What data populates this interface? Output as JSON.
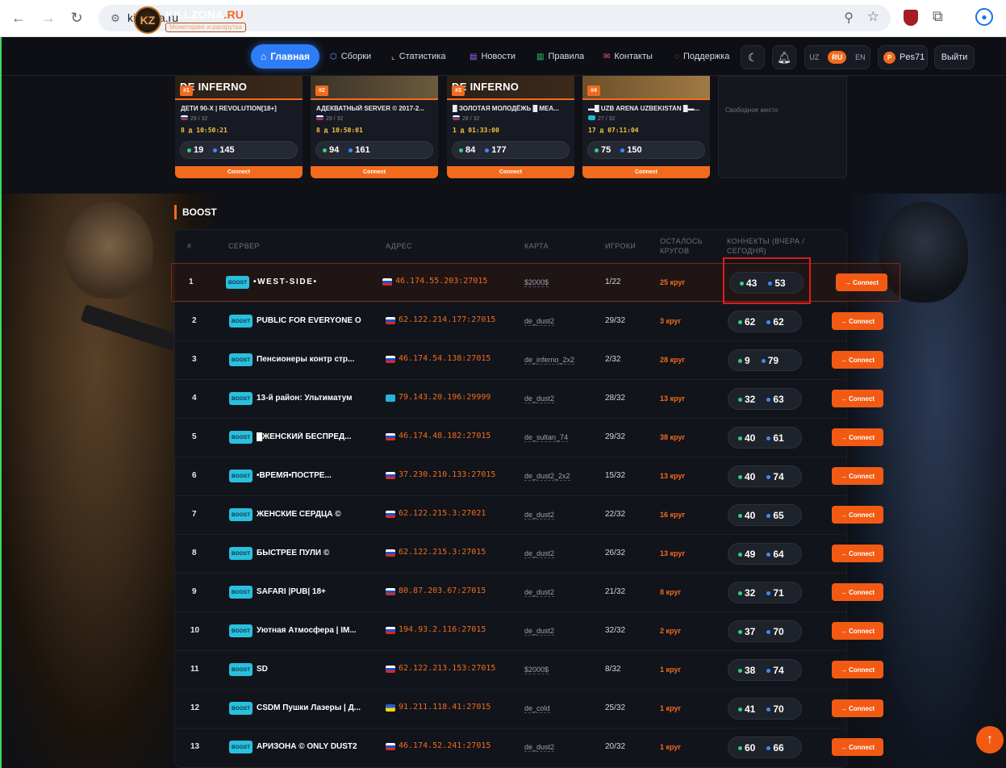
{
  "browser": {
    "url": "killzona.ru"
  },
  "header": {
    "logo_mark": "KZ",
    "logo_main": "KILLZONA",
    "logo_tld": ".RU",
    "logo_sub": "Мониторинг и раскрутка",
    "nav": [
      {
        "label": "Главная",
        "icon": "home-icon"
      },
      {
        "label": "Сборки",
        "icon": "box-icon"
      },
      {
        "label": "Статистика",
        "icon": "chart-icon"
      },
      {
        "label": "Новости",
        "icon": "news-icon"
      },
      {
        "label": "Правила",
        "icon": "rules-icon"
      },
      {
        "label": "Контакты",
        "icon": "mail-icon"
      },
      {
        "label": "Поддержка",
        "icon": "support-icon"
      }
    ],
    "langs": [
      "UZ",
      "RU",
      "EN"
    ],
    "active_lang": "RU",
    "user": {
      "initial": "P",
      "name": "Pes71"
    },
    "logout_label": "Выйти"
  },
  "top_cards": [
    {
      "banner": "DE INFERNO",
      "rank": "#1",
      "name": "ДЕТИ 90-Х | REVOLUTION[18+]",
      "players": "29 / 32",
      "timer": "8 д 10:50:21",
      "green": "19",
      "blue": "145",
      "connect": "Connect"
    },
    {
      "banner": "",
      "rank": "#2",
      "name": "АДЕКВАТНЫЙ SERVER © 2017-2...",
      "players": "29 / 32",
      "timer": "8 д 10:50:01",
      "green": "94",
      "blue": "161",
      "connect": "Connect"
    },
    {
      "banner": "DE INFERNO",
      "rank": "#3",
      "name": "█ ЗОЛОТАЯ МОЛОДЁЖЬ █ MEA...",
      "players": "28 / 32",
      "timer": "1 д 01:33:00",
      "green": "84",
      "blue": "177",
      "connect": "Connect"
    },
    {
      "banner": "",
      "rank": "#4",
      "name": "▬█ UZB ARENA UZBEKISTAN █▬...",
      "players": "27 / 32",
      "timer": "17 д 07:11:04",
      "green": "75",
      "blue": "150",
      "connect": "Connect"
    }
  ],
  "free_slot": "Свободное место",
  "boost": {
    "heading": "BOOST",
    "columns": {
      "num": "#",
      "server": "СЕРВЕР",
      "address": "АДРЕС",
      "map": "КАРТА",
      "players": "ИГРОКИ",
      "rounds": "ОСТАЛОСЬ КРУГОВ",
      "connects": "КОННЕКТЫ (ВЧЕРА / СЕГОДНЯ)"
    },
    "badge": "BOOST",
    "connect_label": "→ Connect",
    "rows": [
      {
        "n": "1",
        "name": "•WEST-SIDE•",
        "flag": "ru",
        "addr": "46.174.55.203:27015",
        "map": "$2000$",
        "players": "1/22",
        "rounds": "25 круг",
        "y": "43",
        "t": "53"
      },
      {
        "n": "2",
        "name": "PUBLIC FOR EVERYONE O...",
        "flag": "ru",
        "addr": "62.122.214.177:27015",
        "map": "de_dust2",
        "players": "29/32",
        "rounds": "3 круг",
        "y": "62",
        "t": "62"
      },
      {
        "n": "3",
        "name": "Пенсионеры контр стр...",
        "flag": "ru",
        "addr": "46.174.54.138:27015",
        "map": "de_inferno_2x2",
        "players": "2/32",
        "rounds": "28 круг",
        "y": "9",
        "t": "79"
      },
      {
        "n": "4",
        "name": "13-й район: Ультиматум",
        "flag": "kz",
        "addr": "79.143.20.196:29999",
        "map": "de_dust2",
        "players": "28/32",
        "rounds": "13 круг",
        "y": "32",
        "t": "63"
      },
      {
        "n": "5",
        "name": "█ЖЕНСКИЙ БЕСПРЕД...",
        "flag": "ru",
        "addr": "46.174.48.182:27015",
        "map": "de_sultan_74",
        "players": "29/32",
        "rounds": "38 круг",
        "y": "40",
        "t": "61"
      },
      {
        "n": "6",
        "name": "•ВРЕМЯ•ПОСТРЕ...",
        "flag": "ru",
        "addr": "37.230.210.133:27015",
        "map": "de_dust2_2x2",
        "players": "15/32",
        "rounds": "13 круг",
        "y": "40",
        "t": "74"
      },
      {
        "n": "7",
        "name": "ЖЕНСКИЕ СЕРДЦА ©",
        "flag": "ru",
        "addr": "62.122.215.3:27021",
        "map": "de_dust2",
        "players": "22/32",
        "rounds": "16 круг",
        "y": "40",
        "t": "65"
      },
      {
        "n": "8",
        "name": "БЫСТРЕЕ ПУЛИ ©",
        "flag": "ru",
        "addr": "62.122.215.3:27015",
        "map": "de_dust2",
        "players": "26/32",
        "rounds": "13 круг",
        "y": "49",
        "t": "64"
      },
      {
        "n": "9",
        "name": "SAFARI |PUB| 18+",
        "flag": "ru",
        "addr": "80.87.203.67:27015",
        "map": "de_dust2",
        "players": "21/32",
        "rounds": "8 круг",
        "y": "32",
        "t": "71"
      },
      {
        "n": "10",
        "name": "Уютная Атмосфера | IM...",
        "flag": "ru",
        "addr": "194.93.2.116:27015",
        "map": "de_dust2",
        "players": "32/32",
        "rounds": "2 круг",
        "y": "37",
        "t": "70"
      },
      {
        "n": "11",
        "name": "SD",
        "flag": "ru",
        "addr": "62.122.213.153:27015",
        "map": "$2000$",
        "players": "8/32",
        "rounds": "1 круг",
        "y": "38",
        "t": "74"
      },
      {
        "n": "12",
        "name": "CSDM Пушки Лазеры | Д...",
        "flag": "ua",
        "addr": "91.211.118.41:27015",
        "map": "de_cold",
        "players": "25/32",
        "rounds": "1 круг",
        "y": "41",
        "t": "70"
      },
      {
        "n": "13",
        "name": "АРИЗОНА © ONLY DUST2",
        "flag": "ru",
        "addr": "46.174.52.241:27015",
        "map": "de_dust2",
        "players": "20/32",
        "rounds": "1 круг",
        "y": "60",
        "t": "66"
      }
    ]
  }
}
